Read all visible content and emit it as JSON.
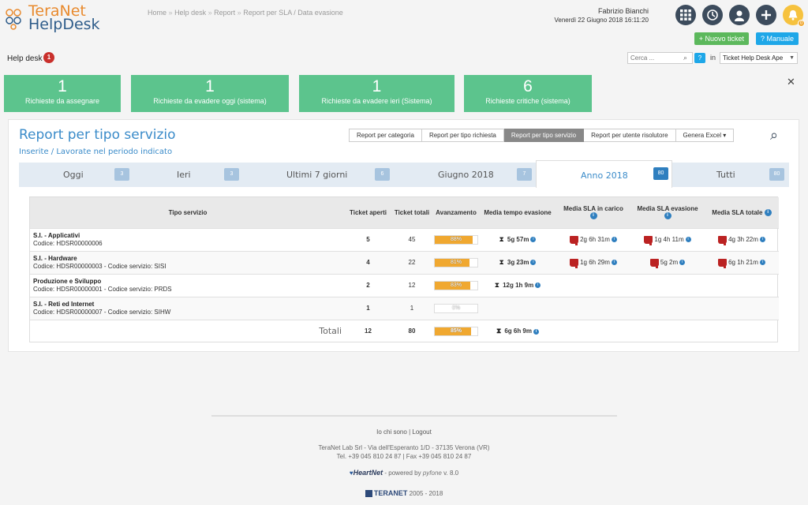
{
  "app": {
    "logo_line1": "TeraNet",
    "logo_line2": "HelpDesk",
    "brand_orange": "#e88a2e",
    "brand_blue": "#2e5c8a"
  },
  "breadcrumb": [
    "Home",
    "Help desk",
    "Report",
    "Report per SLA / Data evasione"
  ],
  "user": {
    "name": "Fabrizio Bianchi",
    "date": "Venerdì 22 Giugno 2018 16:11:20"
  },
  "header_icons": [
    "apps-grid-icon",
    "history-icon",
    "user-icon",
    "add-icon",
    "bell-icon"
  ],
  "notification_badge": "0",
  "buttons": {
    "new_ticket": "Nuovo ticket",
    "manual": "Manuale"
  },
  "helpdesk": {
    "label": "Help desk",
    "badge": "1"
  },
  "search": {
    "placeholder": "Cerca ...",
    "help": "?",
    "in_label": "in",
    "scope": "Ticket Help Desk Ape"
  },
  "cards": [
    {
      "value": "1",
      "label": "Richieste da assegnare"
    },
    {
      "value": "1",
      "label": "Richieste da evadere oggi (sistema)"
    },
    {
      "value": "1",
      "label": "Richieste da evadere ieri (Sistema)"
    },
    {
      "value": "6",
      "label": "Richieste critiche (sistema)"
    }
  ],
  "card_color": "#5cc48d",
  "report": {
    "title": "Report per tipo servizio",
    "subtitle": "Inserite / Lavorate nel periodo indicato",
    "tabs": [
      "Report per categoria",
      "Report per tipo richiesta",
      "Report per tipo servizio",
      "Report per utente risolutore",
      "Genera Excel"
    ],
    "active_tab": 2
  },
  "periods": [
    {
      "label": "Oggi",
      "count": "3"
    },
    {
      "label": "Ieri",
      "count": "3"
    },
    {
      "label": "Ultimi 7 giorni",
      "count": "6"
    },
    {
      "label": "Giugno 2018",
      "count": "7"
    },
    {
      "label": "Anno 2018",
      "count": "80"
    },
    {
      "label": "Tutti",
      "count": "80"
    }
  ],
  "active_period": 4,
  "table": {
    "headers": [
      "Tipo servizio",
      "Ticket aperti",
      "Ticket totali",
      "Avanzamento",
      "Media tempo evasione",
      "Media SLA in carico",
      "Media SLA evasione",
      "Media SLA totale"
    ],
    "rows": [
      {
        "name": "S.I. - Applicativi",
        "code": "Codice: HDSR00000006",
        "open": "5",
        "total": "45",
        "progress": 88,
        "progress_label": "88%",
        "avg_time": "5g 57m",
        "sla_carico": "2g 6h 31m",
        "sla_evasione": "1g 4h 11m",
        "sla_totale": "4g 3h 22m"
      },
      {
        "name": "S.I. - Hardware",
        "code": "Codice: HDSR00000003 - Codice servizio: SISI",
        "open": "4",
        "total": "22",
        "progress": 81,
        "progress_label": "81%",
        "avg_time": "3g 23m",
        "sla_carico": "1g 6h 29m",
        "sla_evasione": "5g 2m",
        "sla_totale": "6g 1h 21m"
      },
      {
        "name": "Produzione e Sviluppo",
        "code": "Codice: HDSR00000001 - Codice servizio: PRDS",
        "open": "2",
        "total": "12",
        "progress": 83,
        "progress_label": "83%",
        "avg_time": "12g 1h 9m",
        "sla_carico": "",
        "sla_evasione": "",
        "sla_totale": ""
      },
      {
        "name": "S.I. - Reti ed Internet",
        "code": "Codice: HDSR00000007 - Codice servizio: SIHW",
        "open": "1",
        "total": "1",
        "progress": 0,
        "progress_label": "0%",
        "avg_time": "",
        "sla_carico": "",
        "sla_evasione": "",
        "sla_totale": ""
      }
    ],
    "totals": {
      "label": "Totali",
      "open": "12",
      "total": "80",
      "progress": 85,
      "progress_label": "85%",
      "avg_time": "6g 6h 9m"
    }
  },
  "footer": {
    "who": "Io chi sono",
    "logout": "Logout",
    "address": "TeraNet Lab Srl - Via dell'Esperanto 1/D - 37135 Verona (VR)",
    "phones": "Tel. +39 045 810 24 87 | Fax +39 045 810 24 87",
    "heartnet": "HeartNet",
    "powered": "- powered by",
    "pyfone": "pyfone",
    "version": "v. 8.0",
    "teranet": "TERANET",
    "years": "2005 - 2018"
  }
}
